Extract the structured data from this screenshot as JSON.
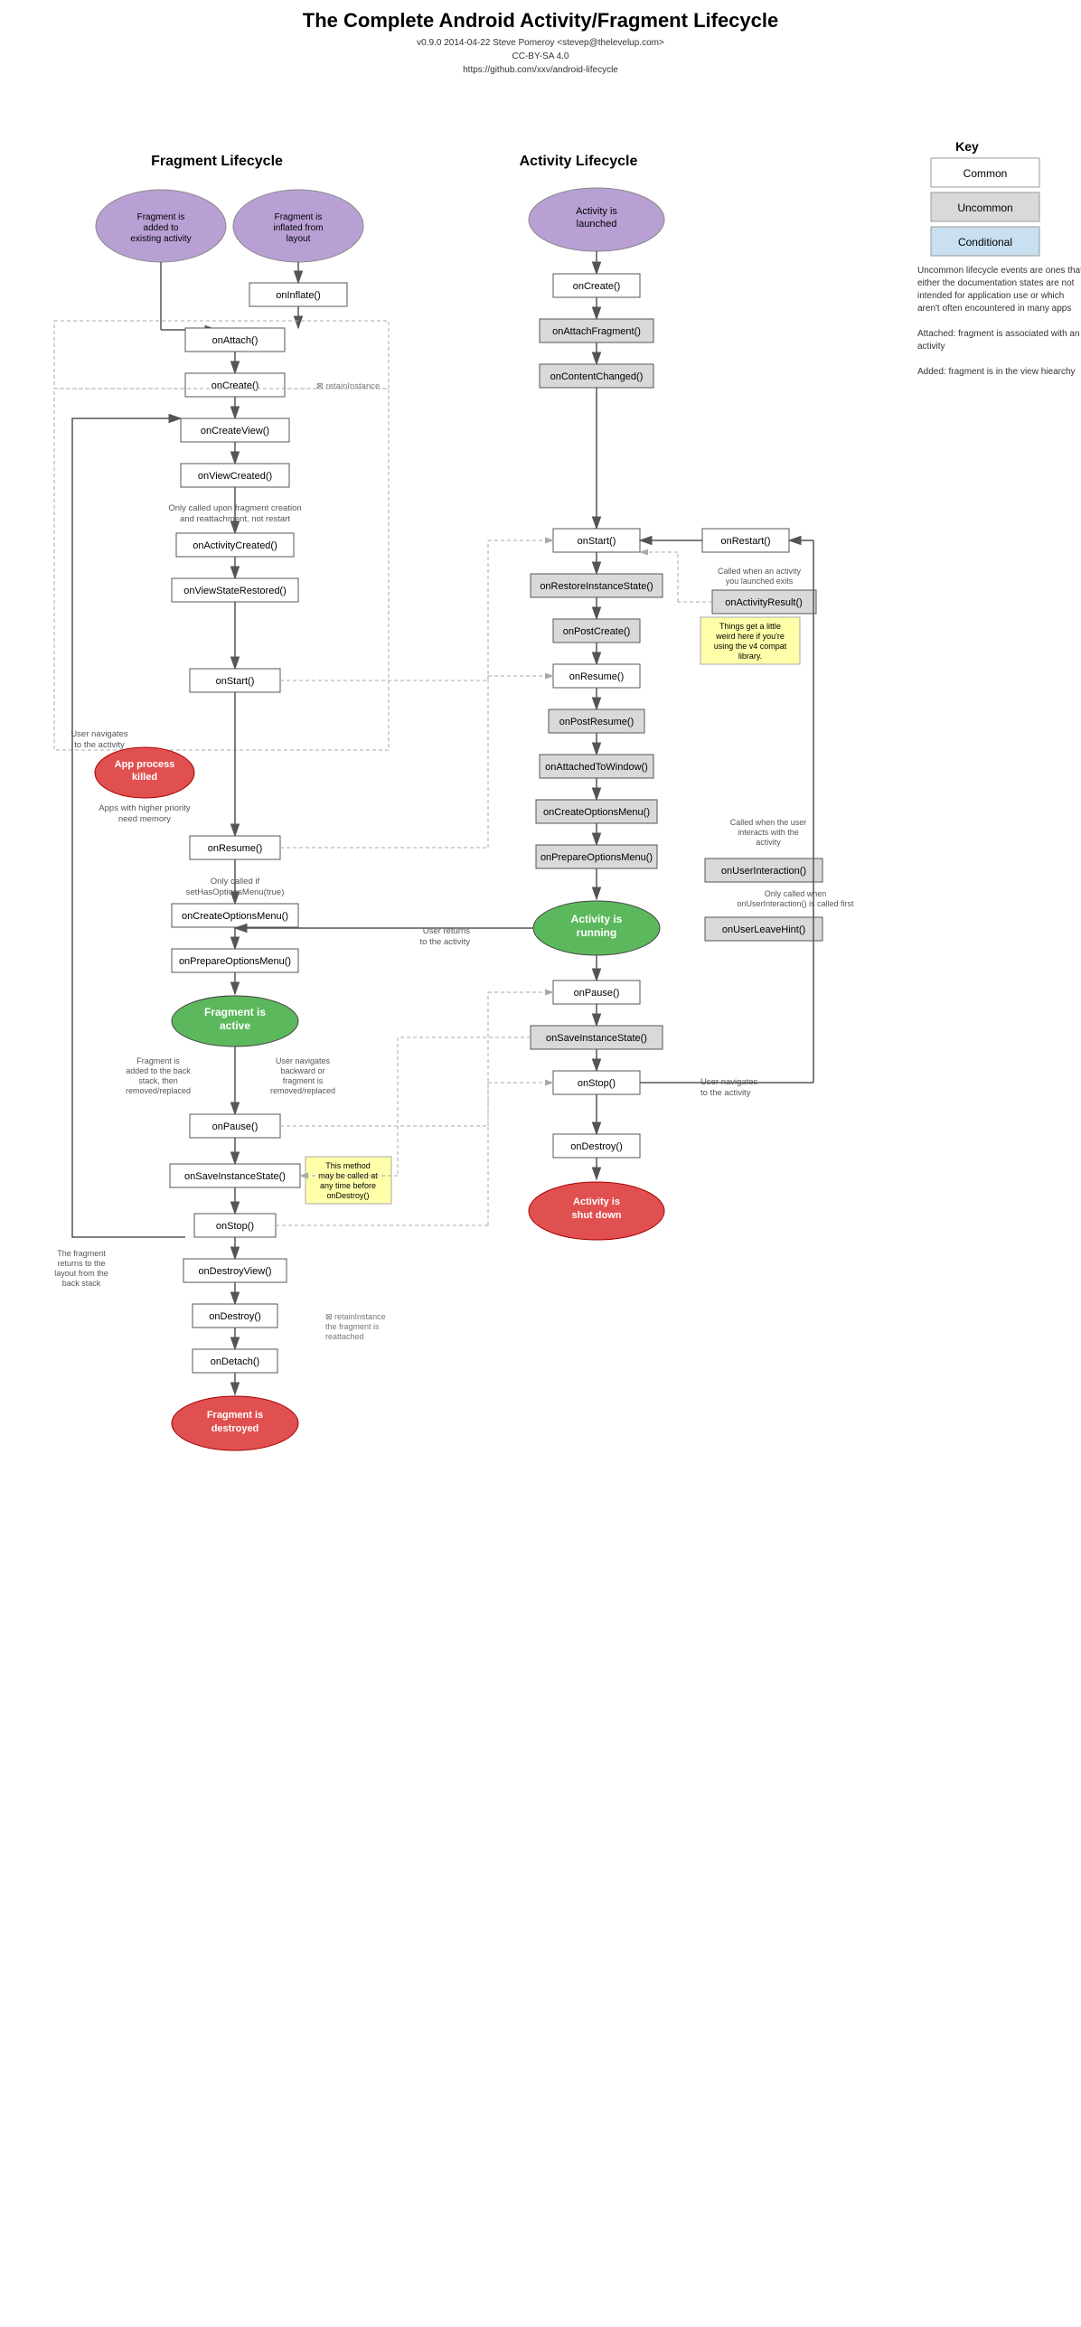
{
  "title": "The Complete Android Activity/Fragment Lifecycle",
  "subtitle_line1": "v0.9.0 2014-04-22 Steve Pomeroy <stevep@thelevelup.com>",
  "subtitle_line2": "CC-BY-SA 4.0",
  "subtitle_line3": "https://github.com/xxv/android-lifecycle",
  "fragment_lifecycle_label": "Fragment Lifecycle",
  "activity_lifecycle_label": "Activity Lifecycle",
  "key_label": "Key",
  "key_common": "Common",
  "key_uncommon": "Uncommon",
  "key_conditional": "Conditional",
  "key_desc": "Uncommon lifecycle events are ones that either the documentation states are not intended for application use or which aren't often encountered in many apps",
  "key_attached": "Attached: fragment is associated with an activity",
  "key_added": "Added: fragment is in the view hiearchy",
  "fragment_start1": "Fragment is added to existing activity",
  "fragment_start2": "Fragment is inflated from layout",
  "onInflate": "onInflate()",
  "onAttach": "onAttach()",
  "onCreate_frag": "onCreate()",
  "retainInstance1": "⊠ retainInstance",
  "onCreateView": "onCreateView()",
  "onViewCreated": "onViewCreated()",
  "note_onActivityCreated": "Only called upon fragment creation and reattachment, not restart",
  "onActivityCreated": "onActivityCreated()",
  "onViewStateRestored": "onViewStateRestored()",
  "onStart_frag": "onStart()",
  "app_process_killed": "App process killed",
  "note_app_killed": "Apps with higher priority need memory",
  "note_user_nav": "User navigates to the activity",
  "onResume_frag": "onResume()",
  "note_only_called": "Only called if setHasOptionsMenu(true)",
  "onCreateOptionsMenu_frag": "onCreateOptionsMenu()",
  "onPrepareOptionsMenu_frag": "onPrepareOptionsMenu()",
  "fragment_active": "Fragment is active",
  "note_frag_back": "Fragment is added to the back stack, then removed/replaced",
  "note_user_nav_back": "User navigates backward or fragment is removed/replaced",
  "onPause_frag": "onPause()",
  "note_method_called": "This method may be called at any time before onDestroy()",
  "onSaveInstanceState_frag": "onSaveInstanceState()",
  "onStop_frag": "onStop()",
  "note_frag_returns": "The fragment returns to the layout from the back stack",
  "onDestroyView": "onDestroyView()",
  "onDestroy_frag": "onDestroy()",
  "retainInstance2": "⊠ retainInstance the fragment is reattached",
  "onDetach": "onDetach()",
  "fragment_destroyed": "Fragment is destroyed",
  "activity_launched": "Activity is launched",
  "onCreate_act": "onCreate()",
  "onAttachFragment": "onAttachFragment()",
  "onContentChanged": "onContentChanged()",
  "onRestart": "onRestart()",
  "onStart_act": "onStart()",
  "note_activity_launched": "Called when an activity you launched exits",
  "onActivityResult": "onActivityResult()",
  "onRestoreInstanceState": "onRestoreInstanceState()",
  "onPostCreate": "onPostCreate()",
  "note_weird": "Things get a little weird here if you're using the v4 compat library.",
  "onResume_act": "onResume()",
  "onPostResume": "onPostResume()",
  "onAttachedToWindow": "onAttachedToWindow()",
  "onCreateOptionsMenu_act": "onCreateOptionsMenu()",
  "note_user_interacts": "Called when the user interacts with the activity",
  "onPrepareOptionsMenu_act": "onPrepareOptionsMenu()",
  "onUserInteraction": "onUserInteraction()",
  "note_only_called_onUser": "Only called when onUserInteraction() is called first",
  "activity_running": "Activity is running",
  "onUserLeaveHint": "onUserLeaveHint()",
  "note_user_returns": "User returns to the activity",
  "onPause_act": "onPause()",
  "onSaveInstanceState_act": "onSaveInstanceState()",
  "onStop_act": "onStop()",
  "note_user_nav_act": "User navigates to the activity",
  "onDestroy_act": "onDestroy()",
  "activity_shutdown": "Activity is shut down"
}
